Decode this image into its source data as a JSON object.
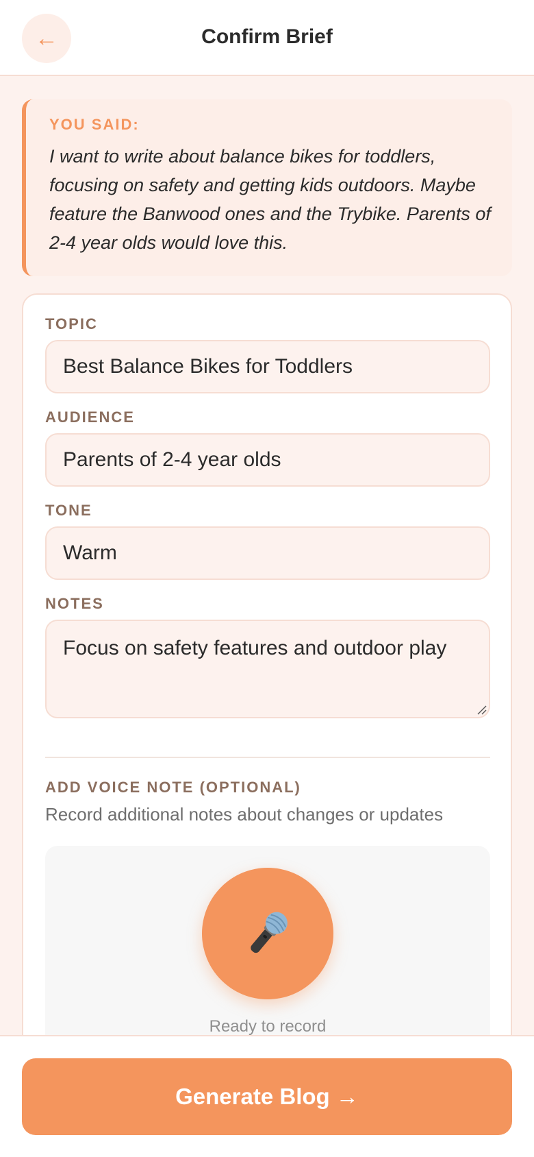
{
  "header": {
    "back_icon": "←",
    "title": "Confirm Brief"
  },
  "you_said": {
    "label": "YOU SAID:",
    "text": "I want to write about balance bikes for toddlers, focusing on safety and getting kids outdoors. Maybe feature the Banwood ones and the Trybike. Parents of 2-4 year olds would love this."
  },
  "form": {
    "topic": {
      "label": "TOPIC",
      "value": "Best Balance Bikes for Toddlers"
    },
    "audience": {
      "label": "AUDIENCE",
      "value": "Parents of 2-4 year olds"
    },
    "tone": {
      "label": "TONE",
      "value": "Warm"
    },
    "notes": {
      "label": "NOTES",
      "value": "Focus on safety features and outdoor play"
    }
  },
  "voice_note": {
    "label": "ADD VOICE NOTE (OPTIONAL)",
    "description": "Record additional notes about changes or updates",
    "mic_icon": "microphone-icon",
    "status": "Ready to record"
  },
  "footer": {
    "generate_label": "Generate Blog →"
  },
  "colors": {
    "accent": "#f4955d",
    "background": "#fdf2ee",
    "label": "#8b6e5e"
  }
}
